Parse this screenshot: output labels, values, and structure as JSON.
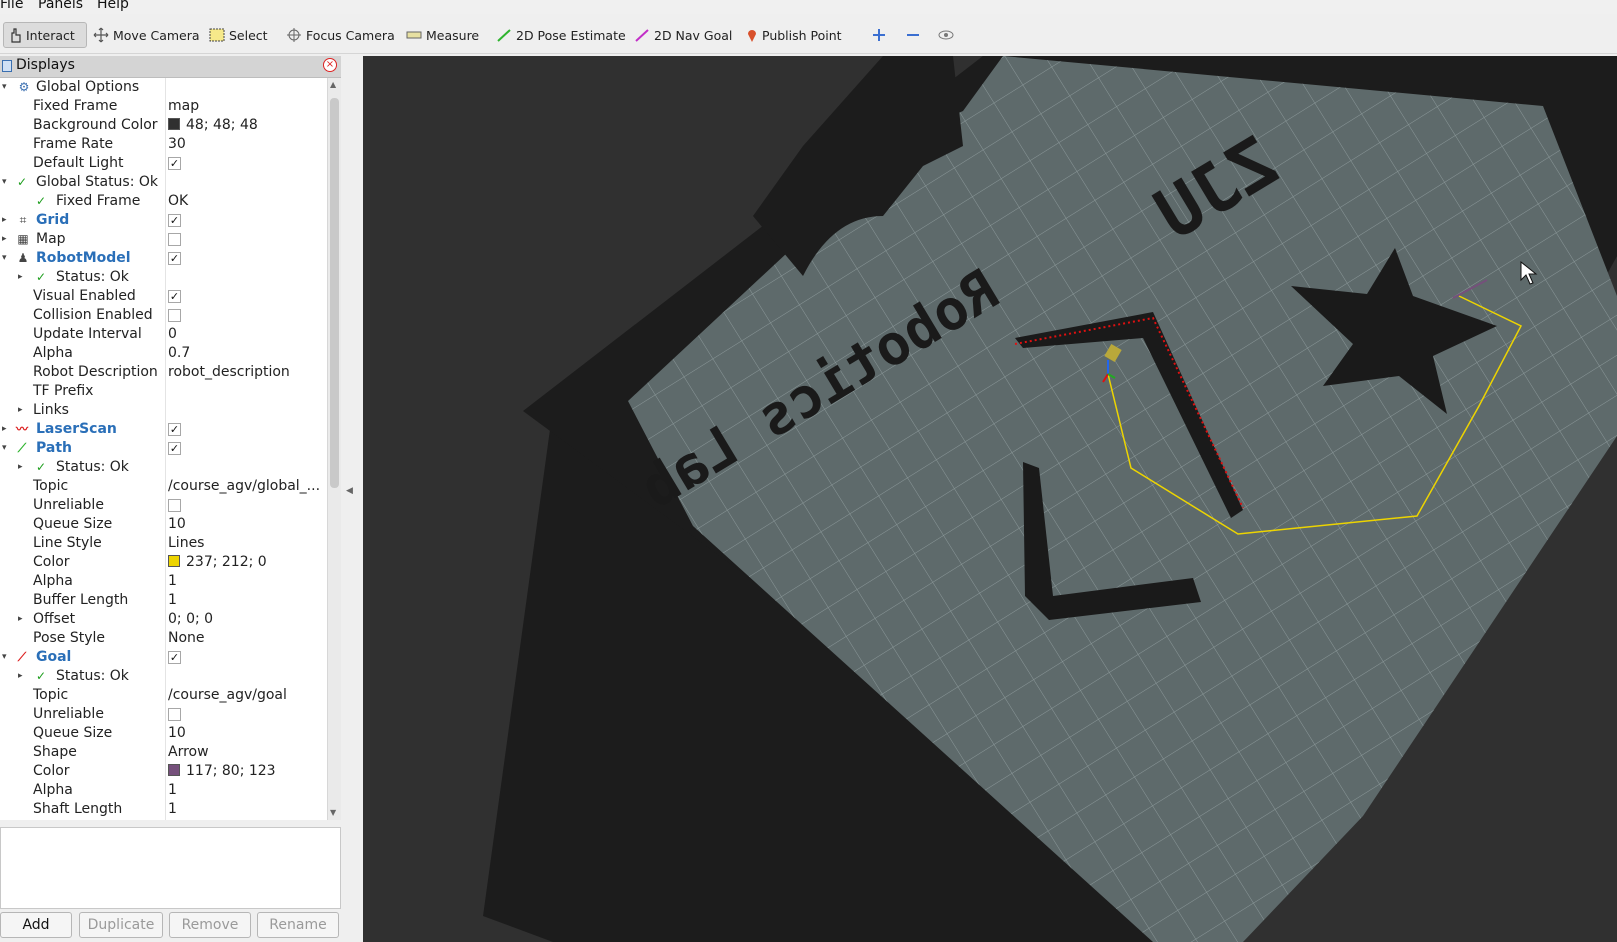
{
  "menu": {
    "file": "File",
    "panels": "Panels",
    "help": "Help"
  },
  "toolbar": {
    "interact": "Interact",
    "move_camera": "Move Camera",
    "select": "Select",
    "focus_camera": "Focus Camera",
    "measure": "Measure",
    "pose_estimate": "2D Pose Estimate",
    "nav_goal": "2D Nav Goal",
    "publish_point": "Publish Point"
  },
  "displays": {
    "title": "Displays",
    "rows": [
      {
        "label": "Global Options",
        "value": ""
      },
      {
        "label": "Fixed Frame",
        "value": "map"
      },
      {
        "label": "Background Color",
        "value": "48; 48; 48"
      },
      {
        "label": "Frame Rate",
        "value": "30"
      },
      {
        "label": "Default Light",
        "value": ""
      },
      {
        "label": "Global Status: Ok",
        "value": ""
      },
      {
        "label": "Fixed Frame",
        "value": "OK"
      },
      {
        "label": "Grid",
        "value": ""
      },
      {
        "label": "Map",
        "value": ""
      },
      {
        "label": "RobotModel",
        "value": ""
      },
      {
        "label": "Status: Ok",
        "value": ""
      },
      {
        "label": "Visual Enabled",
        "value": ""
      },
      {
        "label": "Collision Enabled",
        "value": ""
      },
      {
        "label": "Update Interval",
        "value": "0"
      },
      {
        "label": "Alpha",
        "value": "0.7"
      },
      {
        "label": "Robot Description",
        "value": "robot_description"
      },
      {
        "label": "TF Prefix",
        "value": ""
      },
      {
        "label": "Links",
        "value": ""
      },
      {
        "label": "LaserScan",
        "value": ""
      },
      {
        "label": "Path",
        "value": ""
      },
      {
        "label": "Status: Ok",
        "value": ""
      },
      {
        "label": "Topic",
        "value": "/course_agv/global_..."
      },
      {
        "label": "Unreliable",
        "value": ""
      },
      {
        "label": "Queue Size",
        "value": "10"
      },
      {
        "label": "Line Style",
        "value": "Lines"
      },
      {
        "label": "Color",
        "value": "237; 212; 0"
      },
      {
        "label": "Alpha",
        "value": "1"
      },
      {
        "label": "Buffer Length",
        "value": "1"
      },
      {
        "label": "Offset",
        "value": "0; 0; 0"
      },
      {
        "label": "Pose Style",
        "value": "None"
      },
      {
        "label": "Goal",
        "value": ""
      },
      {
        "label": "Status: Ok",
        "value": ""
      },
      {
        "label": "Topic",
        "value": "/course_agv/goal"
      },
      {
        "label": "Unreliable",
        "value": ""
      },
      {
        "label": "Queue Size",
        "value": "10"
      },
      {
        "label": "Shape",
        "value": "Arrow"
      },
      {
        "label": "Color",
        "value": "117; 80; 123"
      },
      {
        "label": "Alpha",
        "value": "1"
      },
      {
        "label": "Shaft Length",
        "value": "1"
      }
    ]
  },
  "checkboxes": {
    "default_light": true,
    "grid": true,
    "map": false,
    "robot_model": true,
    "visual_enabled": true,
    "collision_enabled": false,
    "laser_scan": true,
    "path": true,
    "path_unreliable": false,
    "goal": true,
    "goal_unreliable": false
  },
  "colors": {
    "background": "#303030",
    "path": "#edd400",
    "goal": "#75507b",
    "accent": "#2a6fb8"
  },
  "buttons": {
    "add": "Add",
    "duplicate": "Duplicate",
    "remove": "Remove",
    "rename": "Rename"
  },
  "map_text": {
    "line1": "Robotics Lab",
    "line2": "ZJU"
  }
}
